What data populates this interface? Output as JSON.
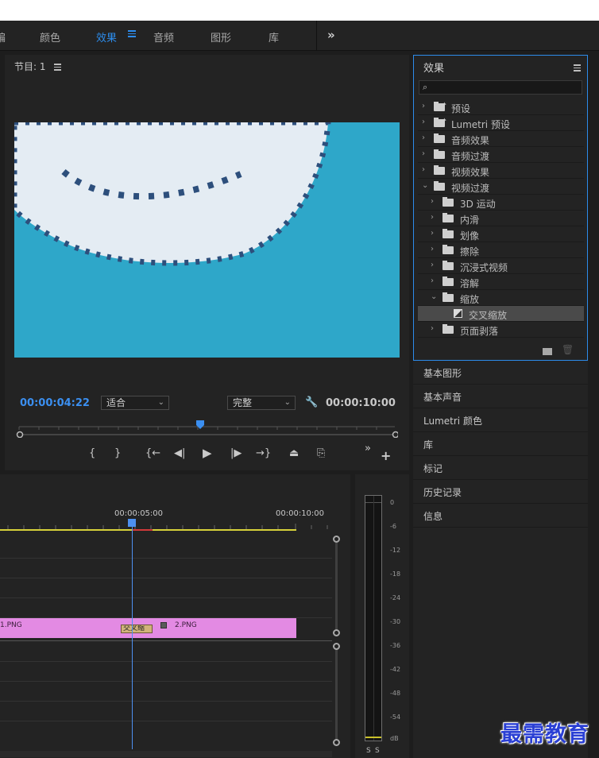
{
  "workspace": {
    "tabs": [
      {
        "label": "编",
        "active": false
      },
      {
        "label": "颜色",
        "active": false
      },
      {
        "label": "效果",
        "active": true
      },
      {
        "label": "音频",
        "active": false
      },
      {
        "label": "图形",
        "active": false
      },
      {
        "label": "库",
        "active": false
      }
    ],
    "more": "»"
  },
  "program": {
    "title": "节目: 1",
    "timecode": "00:00:04:22",
    "fit_select": "适合",
    "quality_select": "完整",
    "duration": "00:00:10:00",
    "wrench_icon": "wrench-icon",
    "controls": [
      "{",
      "}",
      "{←",
      "◀|",
      "▶",
      "|▶",
      "→}",
      "⏏",
      "⎘"
    ],
    "controls_more": "»",
    "add": "+"
  },
  "timeline": {
    "time_5": "00:00:05:00",
    "time_10": "00:00:10:00",
    "clip_left": "1.PNG",
    "transition": "交叉缩",
    "clip_right": "2.PNG"
  },
  "meter": {
    "db_labels": [
      "0",
      "-6",
      "-12",
      "-18",
      "-24",
      "-30",
      "-36",
      "-42",
      "-48",
      "-54",
      "dB"
    ],
    "solo_left": "S",
    "solo_right": "S"
  },
  "effects": {
    "title": "效果",
    "search_placeholder": "",
    "rows": [
      {
        "label": "预设",
        "level": 0,
        "chev": "›",
        "star": true
      },
      {
        "label": "Lumetri 预设",
        "level": 0,
        "chev": "›",
        "star": true
      },
      {
        "label": "音频效果",
        "level": 0,
        "chev": "›"
      },
      {
        "label": "音频过渡",
        "level": 0,
        "chev": "›"
      },
      {
        "label": "视频效果",
        "level": 0,
        "chev": "›"
      },
      {
        "label": "视频过渡",
        "level": 0,
        "chev": "⌄"
      },
      {
        "label": "3D 运动",
        "level": 1,
        "chev": "›"
      },
      {
        "label": "内滑",
        "level": 1,
        "chev": "›"
      },
      {
        "label": "划像",
        "level": 1,
        "chev": "›"
      },
      {
        "label": "擦除",
        "level": 1,
        "chev": "›"
      },
      {
        "label": "沉浸式视频",
        "level": 1,
        "chev": "›"
      },
      {
        "label": "溶解",
        "level": 1,
        "chev": "›"
      },
      {
        "label": "缩放",
        "level": 1,
        "chev": "⌄"
      },
      {
        "label": "交叉缩放",
        "level": 2,
        "selected": true
      },
      {
        "label": "页面剥落",
        "level": 1,
        "chev": "›"
      }
    ]
  },
  "side_panels": [
    "基本图形",
    "基本声音",
    "Lumetri 颜色",
    "库",
    "标记",
    "历史记录",
    "信息"
  ],
  "watermark": "最需教育"
}
